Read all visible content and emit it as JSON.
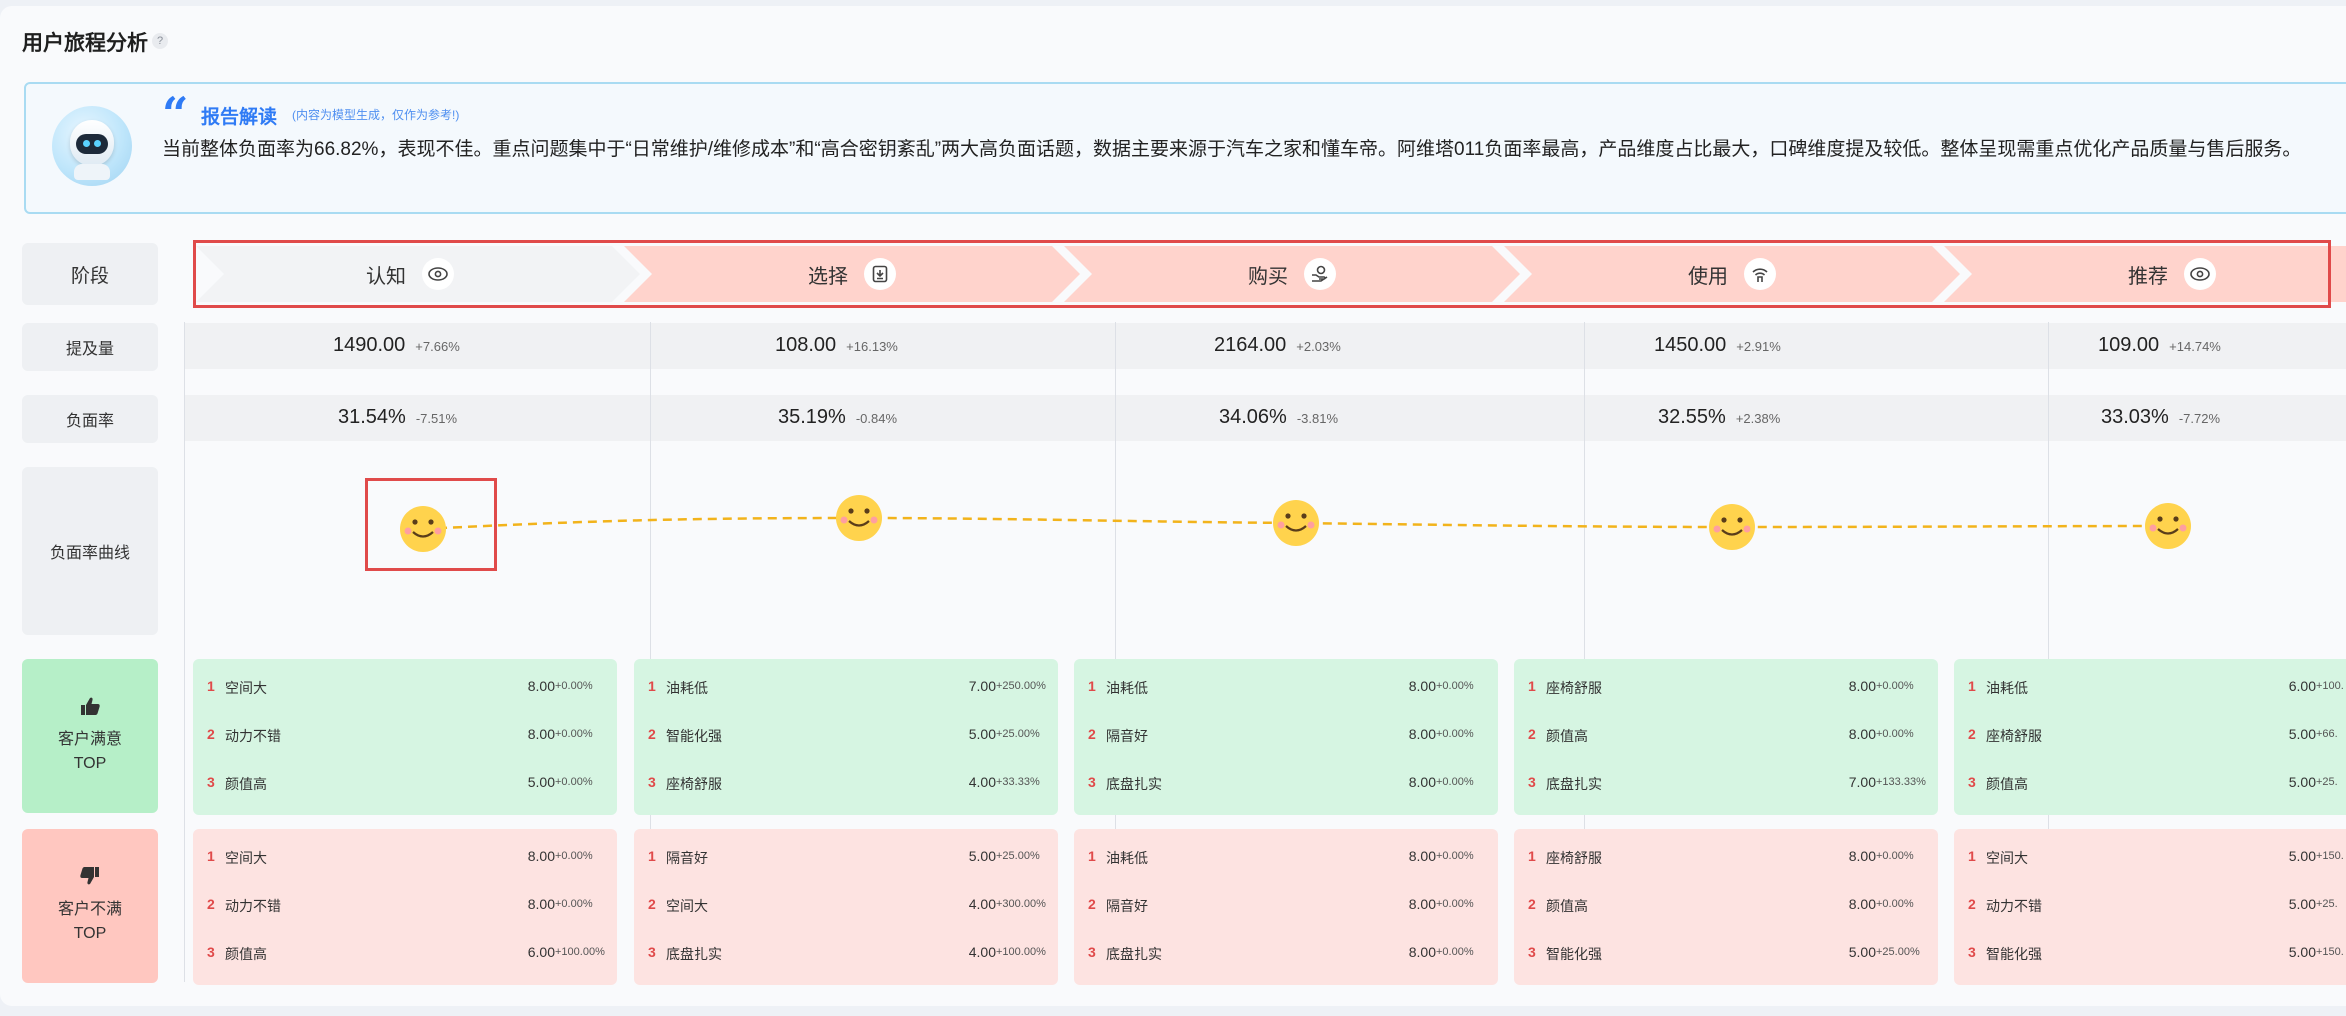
{
  "page_title": "用户旅程分析",
  "help_icon": "?",
  "report": {
    "title": "报告解读",
    "note": "(内容为模型生成，仅作为参考!)",
    "text": "当前整体负面率为66.82%，表现不佳。重点问题集中于“日常维护/维修成本”和“高合密钥紊乱”两大高负面话题，数据主要来源于汽车之家和懂车帝。阿维塔011负面率最高，产品维度占比最大，口碑维度提及较低。整体呈现需重点优化产品质量与售后服务。"
  },
  "row_labels": {
    "stage": "阶段",
    "mention": "提及量",
    "neg_rate": "负面率",
    "curve": "负面率曲线",
    "satisfied": "客户满意",
    "dissatisfied": "客户不满",
    "top": "TOP"
  },
  "stages": [
    {
      "name": "认知",
      "icon": "eye-icon",
      "mention": "1490.00",
      "mention_change": "+7.66%",
      "neg_rate": "31.54%",
      "neg_change": "-7.51%",
      "satisfied": [
        {
          "rank": "1",
          "label": "空间大",
          "value": "8.00",
          "change": "+0.00%"
        },
        {
          "rank": "2",
          "label": "动力不错",
          "value": "8.00",
          "change": "+0.00%"
        },
        {
          "rank": "3",
          "label": "颜值高",
          "value": "5.00",
          "change": "+0.00%"
        }
      ],
      "dissatisfied": [
        {
          "rank": "1",
          "label": "空间大",
          "value": "8.00",
          "change": "+0.00%"
        },
        {
          "rank": "2",
          "label": "动力不错",
          "value": "8.00",
          "change": "+0.00%"
        },
        {
          "rank": "3",
          "label": "颜值高",
          "value": "6.00",
          "change": "+100.00%"
        }
      ]
    },
    {
      "name": "选择",
      "icon": "compare-icon",
      "mention": "108.00",
      "mention_change": "+16.13%",
      "neg_rate": "35.19%",
      "neg_change": "-0.84%",
      "satisfied": [
        {
          "rank": "1",
          "label": "油耗低",
          "value": "7.00",
          "change": "+250.00%"
        },
        {
          "rank": "2",
          "label": "智能化强",
          "value": "5.00",
          "change": "+25.00%"
        },
        {
          "rank": "3",
          "label": "座椅舒服",
          "value": "4.00",
          "change": "+33.33%"
        }
      ],
      "dissatisfied": [
        {
          "rank": "1",
          "label": "隔音好",
          "value": "5.00",
          "change": "+25.00%"
        },
        {
          "rank": "2",
          "label": "空间大",
          "value": "4.00",
          "change": "+300.00%"
        },
        {
          "rank": "3",
          "label": "底盘扎实",
          "value": "4.00",
          "change": "+100.00%"
        }
      ]
    },
    {
      "name": "购买",
      "icon": "purchase-icon",
      "mention": "2164.00",
      "mention_change": "+2.03%",
      "neg_rate": "34.06%",
      "neg_change": "-3.81%",
      "satisfied": [
        {
          "rank": "1",
          "label": "油耗低",
          "value": "8.00",
          "change": "+0.00%"
        },
        {
          "rank": "2",
          "label": "隔音好",
          "value": "8.00",
          "change": "+0.00%"
        },
        {
          "rank": "3",
          "label": "底盘扎实",
          "value": "8.00",
          "change": "+0.00%"
        }
      ],
      "dissatisfied": [
        {
          "rank": "1",
          "label": "油耗低",
          "value": "8.00",
          "change": "+0.00%"
        },
        {
          "rank": "2",
          "label": "隔音好",
          "value": "8.00",
          "change": "+0.00%"
        },
        {
          "rank": "3",
          "label": "底盘扎实",
          "value": "8.00",
          "change": "+0.00%"
        }
      ]
    },
    {
      "name": "使用",
      "icon": "signal-icon",
      "mention": "1450.00",
      "mention_change": "+2.91%",
      "neg_rate": "32.55%",
      "neg_change": "+2.38%",
      "satisfied": [
        {
          "rank": "1",
          "label": "座椅舒服",
          "value": "8.00",
          "change": "+0.00%"
        },
        {
          "rank": "2",
          "label": "颜值高",
          "value": "8.00",
          "change": "+0.00%"
        },
        {
          "rank": "3",
          "label": "底盘扎实",
          "value": "7.00",
          "change": "+133.33%"
        }
      ],
      "dissatisfied": [
        {
          "rank": "1",
          "label": "座椅舒服",
          "value": "8.00",
          "change": "+0.00%"
        },
        {
          "rank": "2",
          "label": "颜值高",
          "value": "8.00",
          "change": "+0.00%"
        },
        {
          "rank": "3",
          "label": "智能化强",
          "value": "5.00",
          "change": "+25.00%"
        }
      ]
    },
    {
      "name": "推荐",
      "icon": "eye-icon",
      "mention": "109.00",
      "mention_change": "+14.74%",
      "neg_rate": "33.03%",
      "neg_change": "-7.72%",
      "satisfied": [
        {
          "rank": "1",
          "label": "油耗低",
          "value": "6.00",
          "change": "+100."
        },
        {
          "rank": "2",
          "label": "座椅舒服",
          "value": "5.00",
          "change": "+66."
        },
        {
          "rank": "3",
          "label": "颜值高",
          "value": "5.00",
          "change": "+25."
        }
      ],
      "dissatisfied": [
        {
          "rank": "1",
          "label": "空间大",
          "value": "5.00",
          "change": "+150."
        },
        {
          "rank": "2",
          "label": "动力不错",
          "value": "5.00",
          "change": "+25."
        },
        {
          "rank": "3",
          "label": "智能化强",
          "value": "5.00",
          "change": "+150."
        }
      ]
    }
  ],
  "colors": {
    "accent": "#2f7bf5",
    "highlight": "#e04a4a",
    "stage_fill": "#ffd3cc",
    "curve": "#f2b31b",
    "satisfied": "#d6f5e2",
    "dissatisfied": "#fde3e1"
  }
}
